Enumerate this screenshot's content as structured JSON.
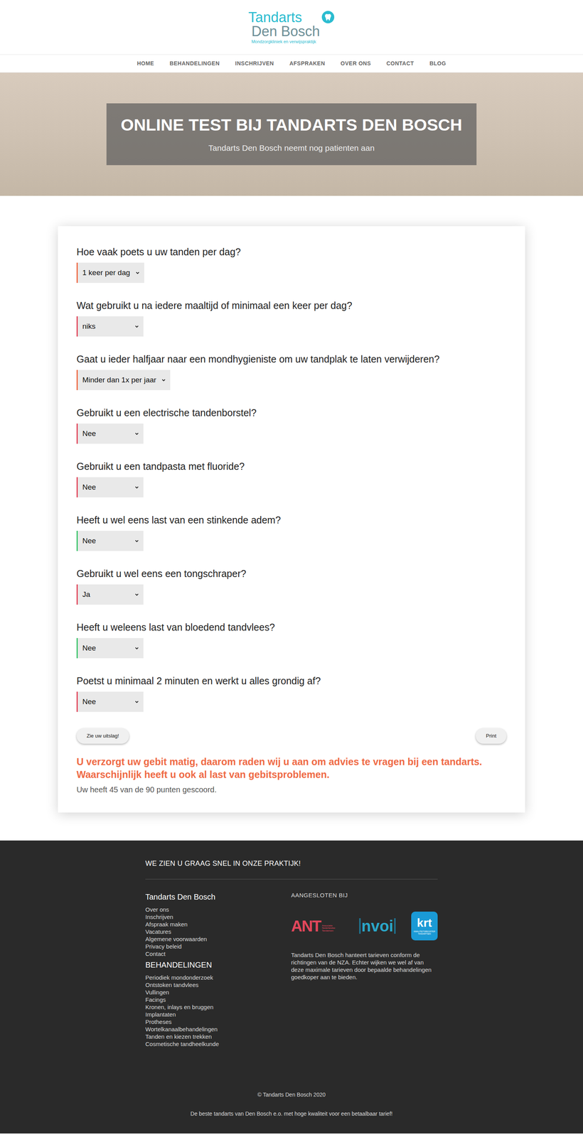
{
  "logo": {
    "line1": "Tandarts",
    "line2": "Den Bosch",
    "tagline": "Mondzorgkliniek en verwijspraktijk"
  },
  "nav": [
    {
      "label": "HOME"
    },
    {
      "label": "BEHANDELINGEN"
    },
    {
      "label": "INSCHRIJVEN"
    },
    {
      "label": "AFSPRAKEN"
    },
    {
      "label": "OVER ONS"
    },
    {
      "label": "CONTACT"
    },
    {
      "label": "BLOG"
    }
  ],
  "hero": {
    "title": "ONLINE TEST BIJ TANDARTS DEN BOSCH",
    "subtitle": "Tandarts Den Bosch neemt nog patienten aan"
  },
  "quiz": {
    "questions": [
      {
        "question": "Hoe vaak poets u uw tanden per dag?",
        "answer": "1 keer per dag",
        "color": "#ef6a45"
      },
      {
        "question": "Wat gebruikt u na iedere maaltijd of minimaal een keer per dag?",
        "answer": "niks",
        "color": "#e2475c"
      },
      {
        "question": "Gaat u ieder halfjaar naar een mondhygieniste om uw tandplak te laten verwijderen?",
        "answer": "Minder dan 1x per jaar",
        "color": "#ef6a45"
      },
      {
        "question": "Gebruikt u een electrische tandenborstel?",
        "answer": "Nee",
        "color": "#e2475c"
      },
      {
        "question": "Gebruikt u een tandpasta met fluoride?",
        "answer": "Nee",
        "color": "#e2475c"
      },
      {
        "question": "Heeft u wel eens last van een stinkende adem?",
        "answer": "Nee",
        "color": "#3cc46b"
      },
      {
        "question": "Gebruikt u wel eens een tongschraper?",
        "answer": "Ja",
        "color": "#e2475c"
      },
      {
        "question": "Heeft u weleens last van bloedend tandvlees?",
        "answer": "Nee",
        "color": "#3cc46b"
      },
      {
        "question": "Poetst u minimaal 2 minuten en werkt u alles grondig af?",
        "answer": "Nee",
        "color": "#e2475c"
      }
    ],
    "submit": "Zie uw uitslag!",
    "print": "Print",
    "verdict": "U verzorgt uw gebit matig, daarom raden wij u aan om advies te vragen bij een tandarts. Waarschijnlijk heeft u ook al last van gebitsproblemen.",
    "score": "Uw heeft 45 van de 90 punten gescoord."
  },
  "footer": {
    "title": "WE ZIEN U GRAAG SNEL IN ONZE PRAKTIJK!",
    "practice_heading": "Tandarts Den Bosch",
    "practice_links": [
      "Over ons",
      "Inschrijven",
      "Afspraak maken",
      "Vacatures",
      "Algemene voorwaarden",
      "Privacy beleid",
      "Contact"
    ],
    "treatments_heading": "BEHANDELINGEN",
    "treatments_links": [
      "Periodiek mondonderzoek",
      "Ontstoken tandvlees",
      "Vullingen",
      "Facings",
      "Kronen, inlays en bruggen",
      "Implantaten",
      "Protheses",
      "Wortelkanaalbehandelingen",
      "Tanden en kiezen trekken",
      "Cosmetische tandheelkunde"
    ],
    "affiliated_heading": "AANGESLOTEN BIJ",
    "affiliations": [
      {
        "name": "ANT",
        "sub": "Associatie Nederlandse Tandartsen"
      },
      {
        "name": "nvoi",
        "sub": ""
      },
      {
        "name": "krt",
        "sub": "KWALITEITSREGISTER TANDARTSEN"
      }
    ],
    "rates": "Tandarts Den Bosch hanteert tarieven conform de richtingen van de NZA. Echter wijken we wel af van deze maximale tarieven door bepaalde behandelingen goedkoper aan te bieden.",
    "copyright": "© Tandarts Den Bosch 2020",
    "tagline": "De beste tandarts van Den Bosch e.o. met hoge kwaliteit voor een betaalbaar tarief!"
  }
}
